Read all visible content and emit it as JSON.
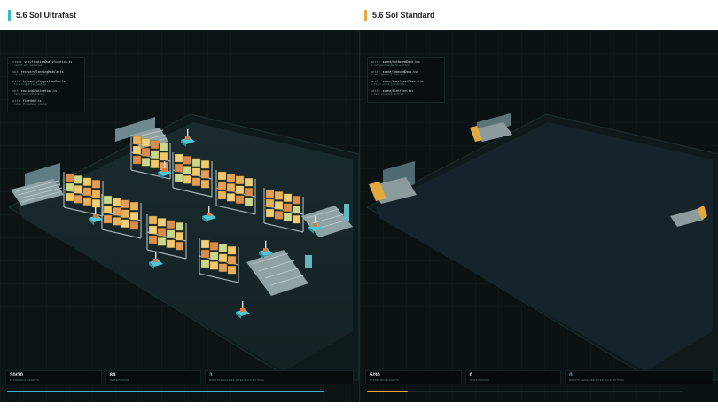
{
  "panels": [
    {
      "title": "5.6 Sol Ultrafast",
      "accent": "#3fb9c9",
      "log": [
        {
          "kind": "create",
          "file": "verificationQualification.ts",
          "note": "+ submit env qualified"
        },
        {
          "kind": "edit",
          "file": "recoveryPlanningModule.ts",
          "note": "+ recovery planner routing"
        },
        {
          "kind": "write",
          "file": "telemetryCongestionMap.ts",
          "note": "+ live congestion heatmap"
        },
        {
          "kind": "edit",
          "file": "routingArbitration.ts",
          "note": "+ lane claim arbitration"
        },
        {
          "kind": "write",
          "file": "fleetHUD.ts",
          "note": "+ robot throughput counter"
        }
      ],
      "stats": [
        {
          "value": "30/30",
          "label": "SYSTEM BUILD EVENTS"
        },
        {
          "value": "84",
          "label": "TESTS PASSING"
        },
        {
          "value": "3",
          "label": "ROBOTS SIMULATED AFTER BUILD MOTIONS"
        }
      ],
      "progress": 1.0
    },
    {
      "title": "5.6 Sol Standard",
      "accent": "#e3a93d",
      "log": [
        {
          "kind": "write",
          "file": "scene/OutboundDock.tsx",
          "note": "+ outbound geometry scaffold"
        },
        {
          "kind": "write",
          "file": "scene/InboundDock.tsx",
          "note": "+ dock geometry scaffold"
        },
        {
          "kind": "write",
          "file": "scene/WarehouseFloor.tsx",
          "note": "+ floor plane placeholder"
        },
        {
          "kind": "write",
          "file": "scene/Platform.tsx",
          "note": "+ base platform mounted"
        }
      ],
      "stats": [
        {
          "value": "5/30",
          "label": "SYSTEM BUILD EVENTS"
        },
        {
          "value": "0",
          "label": "TESTS PASSING"
        },
        {
          "value": "0",
          "label": "ROBOTS SIMULATED AFTER BUILD MOTIONS"
        }
      ],
      "progress": 0.13
    }
  ],
  "icons": [
    "rack-icon",
    "robot-icon",
    "conveyor-icon"
  ]
}
